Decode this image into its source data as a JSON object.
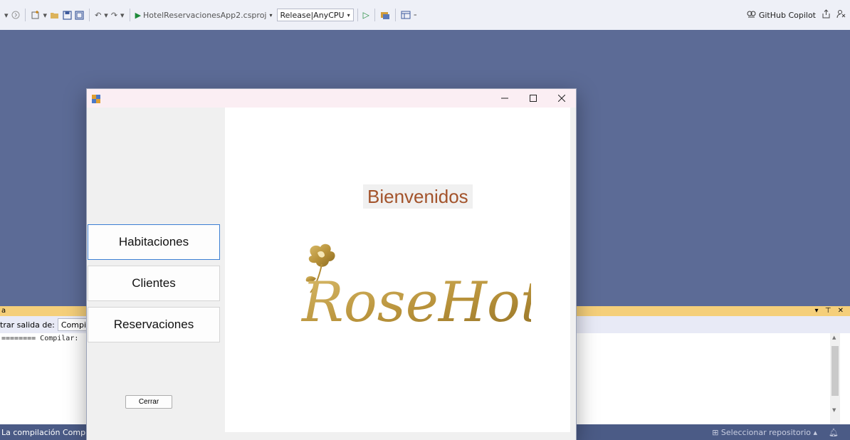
{
  "toolbar": {
    "project": "HotelReservacionesApp2.csproj",
    "config": "Release|AnyCPU",
    "copilot": "GitHub Copilot"
  },
  "output_panel": {
    "title_fragment": "a",
    "show_output_label": "trar salida de:",
    "show_output_value": "Compila",
    "line": "======== Compilar:"
  },
  "status_bar": {
    "left": "La compilación Compila",
    "repo": "Seleccionar repositorio"
  },
  "form": {
    "nav": [
      "Habitaciones",
      "Clientes",
      "Reservaciones"
    ],
    "close_label": "Cerrar",
    "welcome": "Bienvenidos",
    "logo_text": "RoseHotel"
  },
  "colors": {
    "ide_bg": "#5c6b96",
    "welcome_text": "#a3532b",
    "logo_gold": "#b8923a"
  }
}
